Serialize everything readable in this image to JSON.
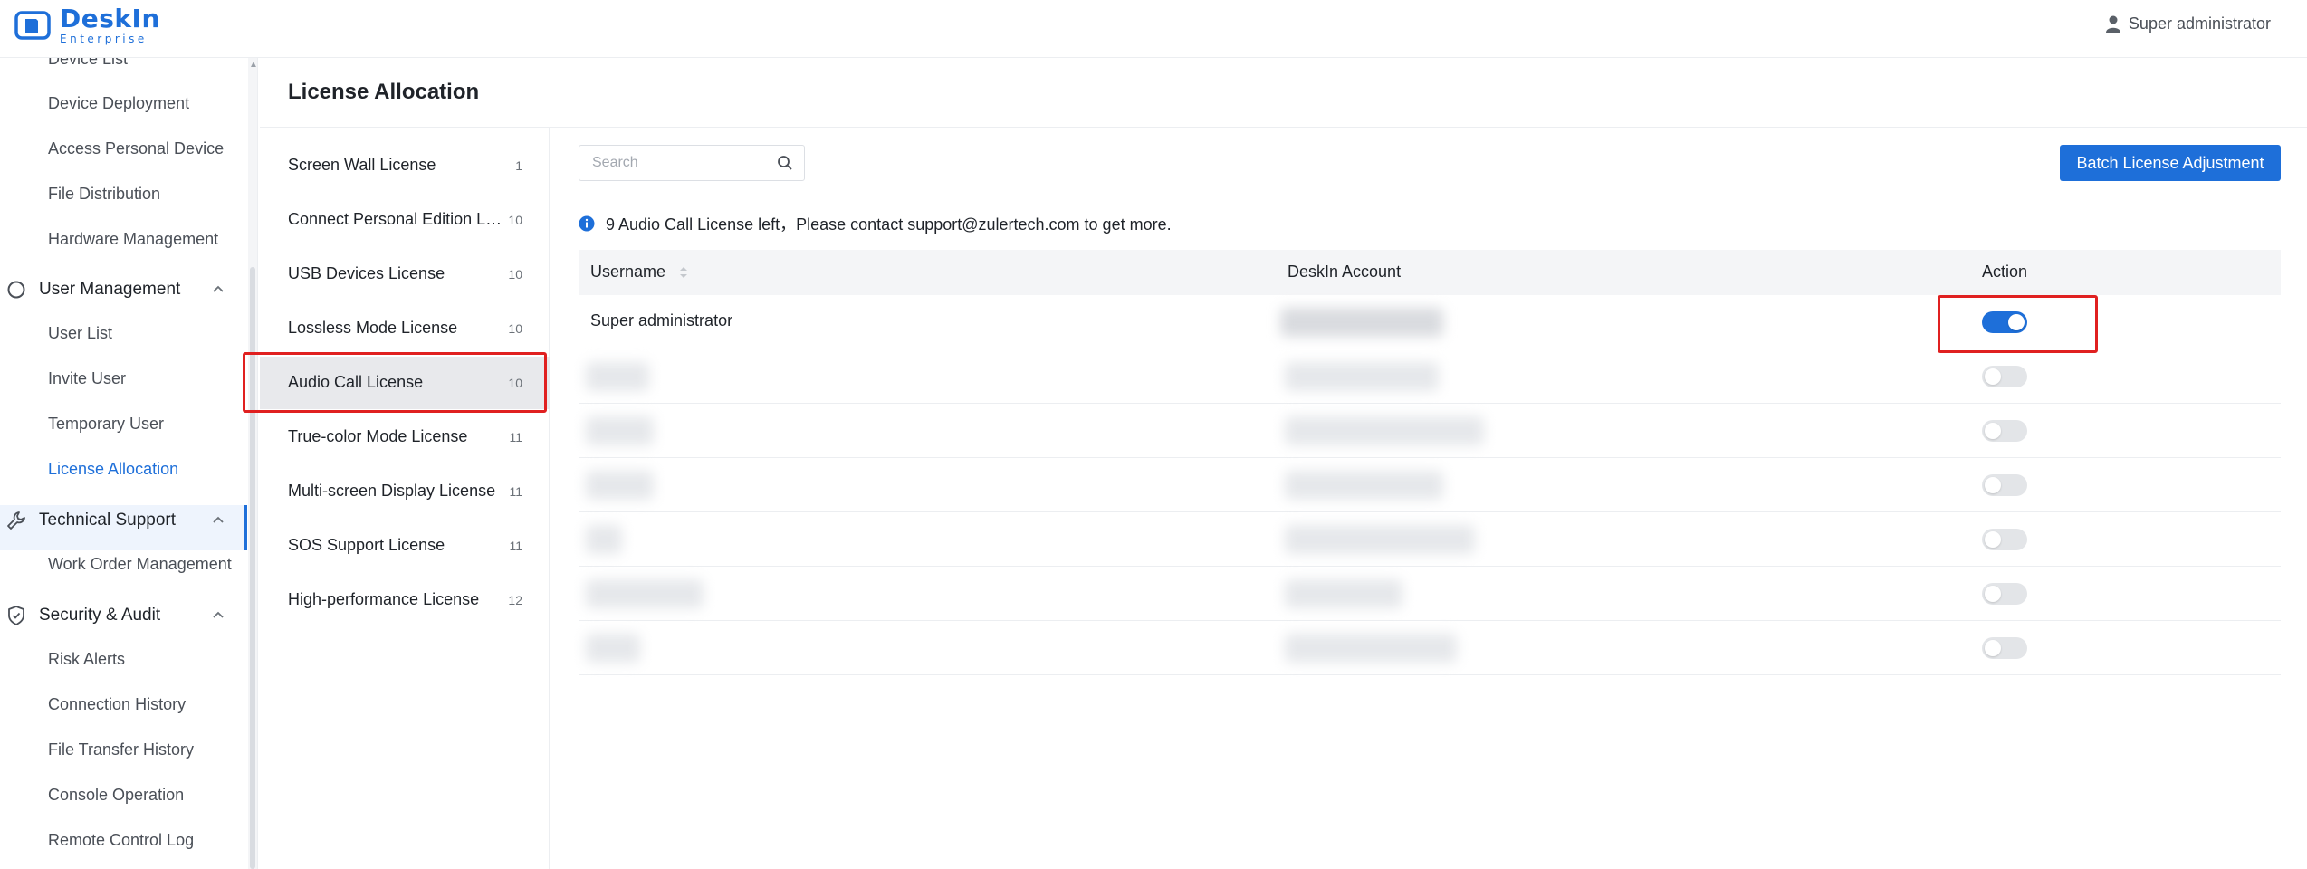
{
  "header": {
    "logo_name": "DeskIn",
    "logo_sub": "Enterprise",
    "user_name": "Super administrator"
  },
  "sidebar": {
    "items_top": [
      {
        "label": "Device List"
      },
      {
        "label": "Device Deployment"
      },
      {
        "label": "Access Personal Device"
      },
      {
        "label": "File Distribution"
      },
      {
        "label": "Hardware Management"
      }
    ],
    "user_management": {
      "label": "User Management",
      "items": [
        {
          "label": "User List"
        },
        {
          "label": "Invite User"
        },
        {
          "label": "Temporary User"
        },
        {
          "label": "License Allocation"
        }
      ]
    },
    "technical_support": {
      "label": "Technical Support",
      "items": [
        {
          "label": "Work Order Management"
        }
      ]
    },
    "security_audit": {
      "label": "Security & Audit",
      "items": [
        {
          "label": "Risk Alerts"
        },
        {
          "label": "Connection History"
        },
        {
          "label": "File Transfer History"
        },
        {
          "label": "Console Operation"
        },
        {
          "label": "Remote Control Log"
        }
      ]
    }
  },
  "page": {
    "title": "License Allocation"
  },
  "licenses": [
    {
      "name": "Screen Wall License",
      "count": "1"
    },
    {
      "name": "Connect Personal Edition License",
      "count": "10"
    },
    {
      "name": "USB Devices License",
      "count": "10"
    },
    {
      "name": "Lossless Mode License",
      "count": "10"
    },
    {
      "name": "Audio Call License",
      "count": "10"
    },
    {
      "name": "True-color Mode License",
      "count": "11"
    },
    {
      "name": "Multi-screen Display License",
      "count": "11"
    },
    {
      "name": "SOS Support License",
      "count": "11"
    },
    {
      "name": "High-performance License",
      "count": "12"
    }
  ],
  "main": {
    "search_placeholder": "Search",
    "batch_button": "Batch License Adjustment",
    "notice": "9 Audio Call License left，Please contact support@zulertech.com to get more."
  },
  "table": {
    "headers": {
      "username": "Username",
      "account": "DeskIn Account",
      "action": "Action"
    },
    "rows": [
      {
        "username": "Super administrator",
        "enabled": true
      },
      {
        "username": "",
        "enabled": false
      },
      {
        "username": "",
        "enabled": false
      },
      {
        "username": "",
        "enabled": false
      },
      {
        "username": "",
        "enabled": false
      },
      {
        "username": "",
        "enabled": false
      },
      {
        "username": "",
        "enabled": false
      }
    ]
  },
  "colors": {
    "accent": "#1e6fd9",
    "highlight": "#e02020"
  }
}
